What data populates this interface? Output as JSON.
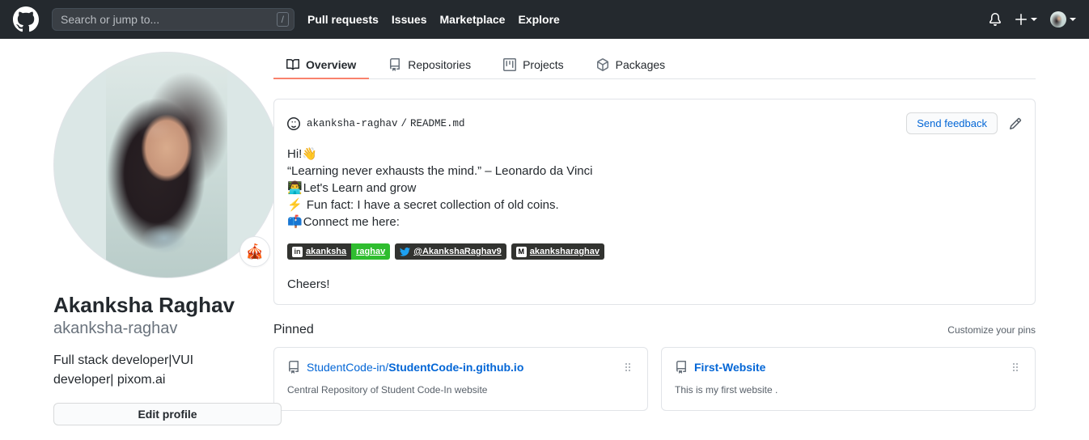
{
  "header": {
    "logo_icon": "github-logo-icon",
    "search": {
      "placeholder": "Search or jump to...",
      "value": "",
      "shortcut": "/"
    },
    "nav": [
      {
        "label": "Pull requests"
      },
      {
        "label": "Issues"
      },
      {
        "label": "Marketplace"
      },
      {
        "label": "Explore"
      }
    ],
    "notifications_icon": "bell-icon",
    "create_new_icon": "plus-icon",
    "account_icon": "avatar-icon"
  },
  "profile": {
    "name": "Akanksha Raghav",
    "login": "akanksha-raghav",
    "bio": "Full stack developer|VUI developer| pixom.ai",
    "edit_profile_label": "Edit profile",
    "status_emoji": "🎪",
    "avatar_alt": "akanksha-raghav"
  },
  "tabs": [
    {
      "label": "Overview",
      "icon": "book-icon",
      "active": true
    },
    {
      "label": "Repositories",
      "icon": "repo-icon",
      "active": false
    },
    {
      "label": "Projects",
      "icon": "project-board-icon",
      "active": false
    },
    {
      "label": "Packages",
      "icon": "package-icon",
      "active": false
    }
  ],
  "readme": {
    "owner": "akanksha-raghav",
    "separator": "/",
    "file": "README.md",
    "send_feedback_label": "Send feedback",
    "edit_icon": "pencil-icon",
    "smiley_icon": "smiley-icon",
    "lines": [
      {
        "emoji": "👋",
        "emoji_first": false,
        "text": "Hi!"
      },
      {
        "emoji": "",
        "emoji_first": false,
        "text": "“Learning never exhausts the mind.” – Leonardo da Vinci"
      },
      {
        "emoji": "👨‍💻",
        "emoji_first": true,
        "text": "Let's Learn and grow"
      },
      {
        "emoji": "⚡",
        "emoji_first": true,
        "text": " Fun fact: I have a secret collection of old coins."
      },
      {
        "emoji": "📫",
        "emoji_first": true,
        "text": "Connect me here:"
      }
    ],
    "badges": [
      {
        "name": "linkedin-badge",
        "icon": "linkedin-icon",
        "glyph": "in",
        "left_text": "akanksha",
        "right_text": "raghav",
        "left_color": "#323330",
        "right_color": "#2fbd2f"
      },
      {
        "name": "twitter-badge",
        "icon": "twitter-icon",
        "glyph": "🐦",
        "left_text": "@AkankshaRaghav9",
        "right_text": "",
        "left_color": "#323330",
        "right_color": ""
      },
      {
        "name": "medium-badge",
        "icon": "medium-icon",
        "glyph": "M",
        "left_text": "akanksharaghav",
        "right_text": "",
        "left_color": "#323330",
        "right_color": ""
      }
    ],
    "closing": "Cheers!"
  },
  "pinned": {
    "title": "Pinned",
    "customize_label": "Customize your pins",
    "cards": [
      {
        "owner": "StudentCode-in/",
        "repo": "StudentCode-in.github.io",
        "description": "Central Repository of Student Code-In website",
        "icon": "repo-icon",
        "drag_icon": "drag-handle-icon"
      },
      {
        "owner": "",
        "repo": "First-Website",
        "description": "This is my first website .",
        "icon": "repo-icon",
        "drag_icon": "drag-handle-icon"
      }
    ]
  },
  "colors": {
    "header_bg": "#24292e",
    "accent_tab": "#f9826c",
    "link": "#0366d6",
    "border": "#e1e4e8",
    "muted_text": "#586069"
  }
}
